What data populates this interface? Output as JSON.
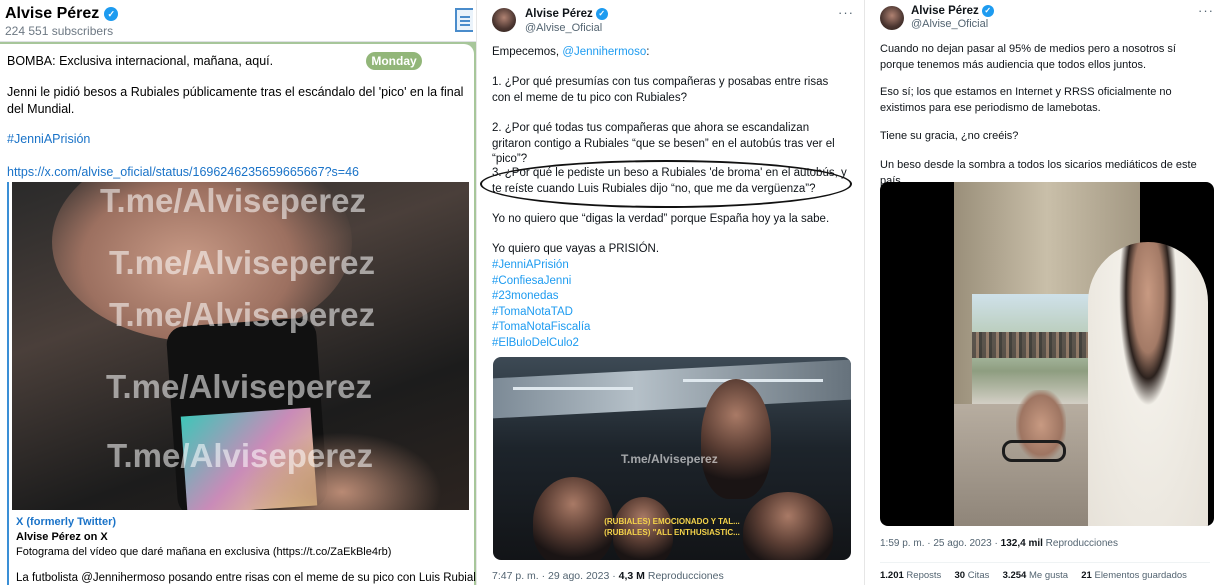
{
  "telegram": {
    "channel_name": "Alvise Pérez",
    "subscribers": "224 551 subscribers",
    "day_badge": "Monday",
    "line1": "BOMBA: Exclusiva internacional, mañana, aquí.",
    "line2": "Jenni le pidió besos a Rubiales públicamente tras el escándalo del 'pico' en la final del Mundial.",
    "hashtag": "#JenniAPrisión",
    "url": "https://x.com/alvise_oficial/status/1696246235659665667?s=46",
    "watermark": "T.me/Alviseperez",
    "preview_source": "X (formerly Twitter)",
    "preview_title": "Alvise Pérez on X",
    "preview_description": "Fotograma del vídeo que daré mañana en exclusiva (https://t.co/ZaEkBle4rb)",
    "bottom_text": "La futbolista @Jennihermoso posando entre risas con el meme de su pico con Luis Rubiales es"
  },
  "tweet1": {
    "name": "Alvise Pérez",
    "handle": "@Alvise_Oficial",
    "more": "···",
    "intro_prefix": "Empecemos, ",
    "intro_mention": "@Jennihermoso",
    "intro_suffix": ":",
    "q1": "1. ¿Por qué presumías con tus compañeras y posabas entre risas con el meme de tu pico con Rubiales?",
    "q2": "2. ¿Por qué todas tus compañeras que ahora se escandalizan gritaron contigo a Rubiales “que se besen” en el autobús tras ver el “pico”?",
    "q3": "3. ¿Por qué le pediste un beso a Rubiales 'de broma' en el autobús, y te reíste cuando Luis Rubiales dijo “no, que me da vergüenza”?",
    "p4": "Yo no quiero que “digas la verdad” porque España hoy ya la sabe.",
    "p5": "Yo quiero que vayas a PRISIÓN.",
    "hashtags": [
      "#JenniAPrisión",
      "#ConfiesaJenni",
      "#23monedas",
      "#TomaNotaTAD",
      "#TomaNotaFiscalía",
      "#ElBuloDelCulo2"
    ],
    "video_watermark": "T.me/Alviseperez",
    "subtitle1": "(RUBIALES) EMOCIONADO Y TAL...",
    "subtitle2": "(RUBIALES) \"ALL ENTHUSIASTIC...",
    "time": "7:47 p. m. · 29 ago. 2023 · ",
    "views": "4,3 M",
    "views_label": " Reproducciones"
  },
  "tweet2": {
    "name": "Alvise Pérez",
    "handle": "@Alvise_Oficial",
    "more": "···",
    "p1": "Cuando no dejan pasar al 95% de medios pero a nosotros sí porque tenemos más audiencia que todos ellos juntos.",
    "p2": "Eso sí; los que estamos en Internet y RRSS oficialmente no existimos para ese periodismo de lamebotas.",
    "p3": "Tiene su gracia, ¿no creéis?",
    "p4": "Un beso desde la sombra a todos los sicarios mediáticos de este país.",
    "time": "1:59 p. m. · 25 ago. 2023 · ",
    "views": "132,4 mil",
    "views_label": " Reproducciones",
    "reposts_count": "1.201",
    "reposts_label": " Reposts",
    "quotes_count": "30",
    "quotes_label": " Citas",
    "likes_count": "3.254",
    "likes_label": " Me gusta",
    "saves_count": "21",
    "saves_label": " Elementos guardados"
  },
  "colors": {
    "telegram_accent": "#3a8fd6",
    "telegram_wallpaper": "#a7c69a",
    "twitter_blue": "#1d9bf0",
    "subtitle_yellow": "#f4d34a"
  },
  "icons": {
    "verified": "verified-badge-icon",
    "menu": "more-options-icon",
    "sidebar_toggle": "sidebar-toggle-icon"
  }
}
